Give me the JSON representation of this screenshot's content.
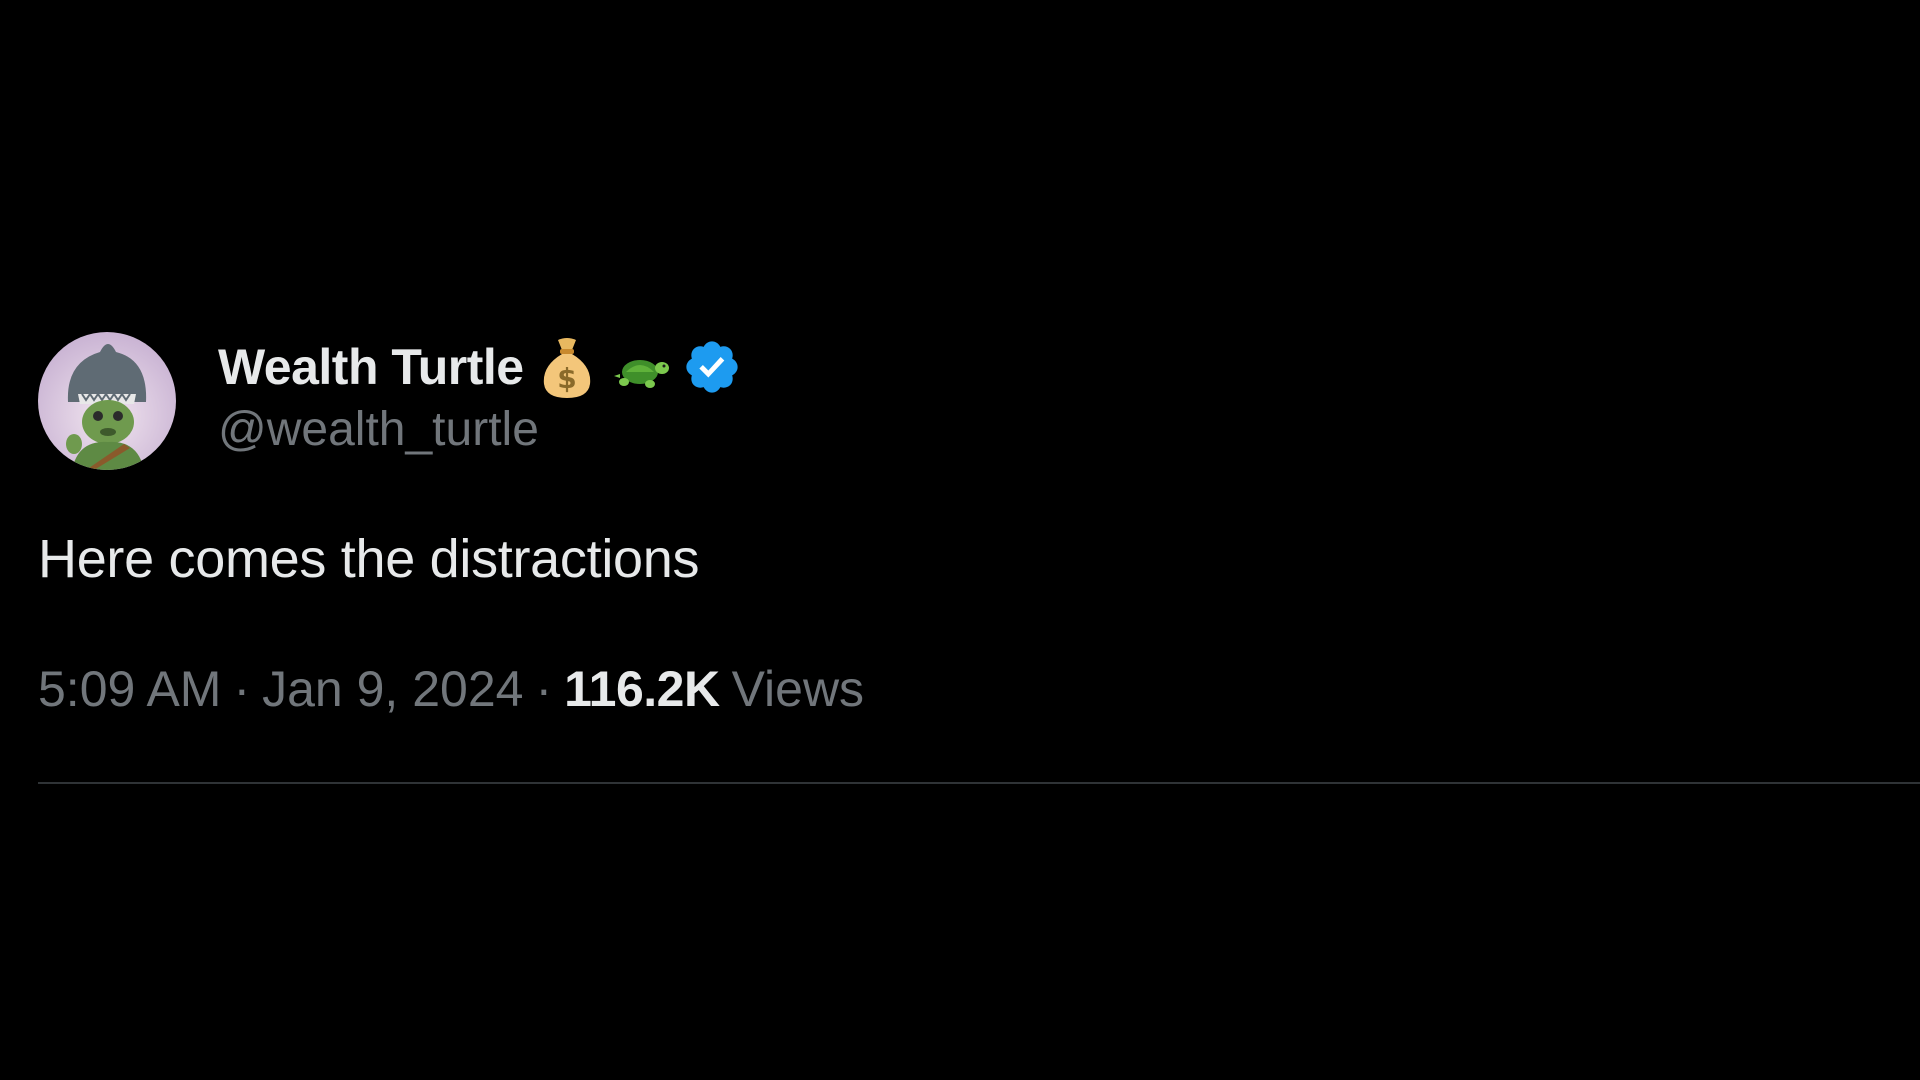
{
  "tweet": {
    "author": {
      "display_name": "Wealth Turtle",
      "handle": "@wealth_turtle",
      "emojis": [
        "money-bag-icon",
        "turtle-icon"
      ],
      "verified": true,
      "verified_color": "#1d9bf0"
    },
    "text": "Here comes the distractions",
    "meta": {
      "time": "5:09 AM",
      "separator": "·",
      "date": "Jan 9, 2024",
      "views_count": "116.2K",
      "views_label": "Views"
    }
  },
  "colors": {
    "background": "#000000",
    "primary_text": "#e7e9ea",
    "secondary_text": "#71767b",
    "divider": "#2f3336"
  }
}
